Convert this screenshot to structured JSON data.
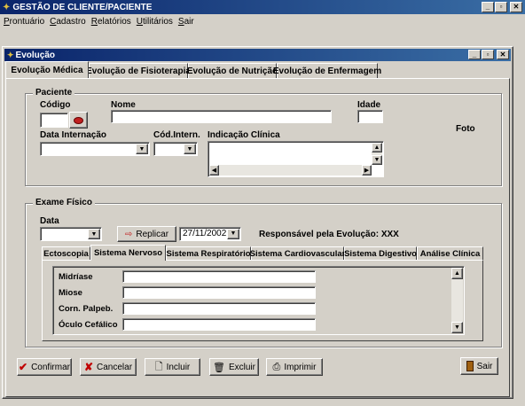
{
  "app": {
    "title": "GESTÃO DE CLIENTE/PACIENTE",
    "menu": [
      {
        "label": "Prontuário"
      },
      {
        "label": "Cadastro"
      },
      {
        "label": "Relatórios"
      },
      {
        "label": "Utilitários"
      },
      {
        "label": "Sair"
      }
    ]
  },
  "window": {
    "title": "Evolução",
    "tabs": [
      "Evolução Médica",
      "Evolução de Fisioterapia",
      "Evolução de Nutrição",
      "Evolução de Enfermagem"
    ],
    "active_tab": "Evolução Médica"
  },
  "paciente": {
    "legend": "Paciente",
    "codigo_label": "Código",
    "codigo_value": "",
    "nome_label": "Nome",
    "nome_value": "",
    "idade_label": "Idade",
    "idade_value": "",
    "data_internacao_label": "Data Internação",
    "data_internacao_value": "",
    "cod_intern_label": "Cód.Intern.",
    "cod_intern_value": "",
    "indicacao_label": "Indicação Clínica",
    "indicacao_value": "",
    "foto_label": "Foto"
  },
  "exame": {
    "legend": "Exame Físico",
    "data_label": "Data",
    "data_value": "",
    "replicar_label": "Replicar",
    "replicar_date": "27/11/2002",
    "responsavel": "Responsável pela Evolução: XXX",
    "tabs": [
      "Ectoscopia",
      "Sistema Nervoso",
      "Sistema Respiratório",
      "Sistema Cardiovascular",
      "Sistema Digestivo",
      "Análise Clínica"
    ],
    "active_tab": "Sistema Nervoso",
    "fields": [
      {
        "label": "Midríase",
        "value": ""
      },
      {
        "label": "Miose",
        "value": ""
      },
      {
        "label": "Corn. Palpeb.",
        "value": ""
      },
      {
        "label": "Óculo Cefálico",
        "value": ""
      }
    ]
  },
  "actions": {
    "confirmar": "Confirmar",
    "cancelar": "Cancelar",
    "incluir": "Incluir",
    "excluir": "Excluir",
    "imprimir": "Imprimir",
    "sair": "Sair"
  },
  "colors": {
    "titlebar": "#0a246a",
    "face": "#d4d0c8"
  },
  "icons": [
    "app-icon",
    "minimize-icon",
    "maximize-icon",
    "close-icon",
    "search-patient-icon",
    "replicar-icon",
    "check-icon",
    "cancel-x-icon",
    "new-document-icon",
    "trash-icon",
    "printer-icon",
    "exit-door-icon"
  ]
}
